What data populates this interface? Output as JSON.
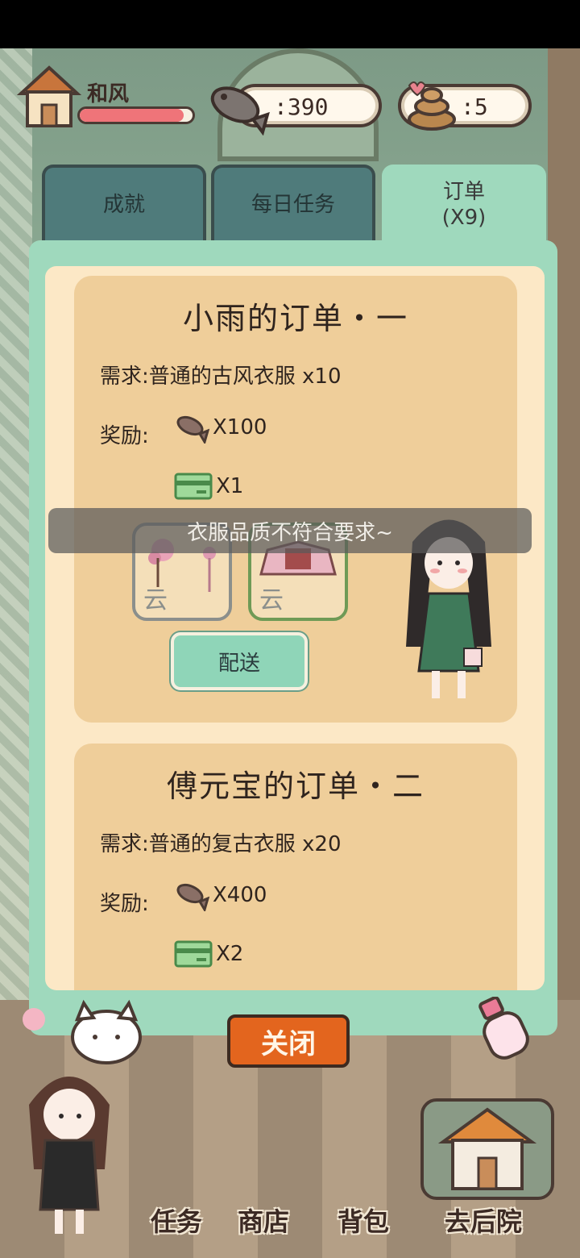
{
  "hud": {
    "player_name": "和风",
    "hp_fraction": 0.92,
    "fish_count": ":390",
    "poop_count": ":5"
  },
  "tabs": {
    "achievement": "成就",
    "daily": "每日任务",
    "order": "订单",
    "order_count": "(X9)"
  },
  "orders": [
    {
      "title": "小雨的订单・一",
      "requirement": "需求:普通的古风衣服 x10",
      "reward_label": "奖励:",
      "reward_fish": "X100",
      "reward_ticket": "X1",
      "deliver_label": "配送"
    },
    {
      "title": "傅元宝的订单・二",
      "requirement": "需求:普通的复古衣服 x20",
      "reward_label": "奖励:",
      "reward_fish": "X400",
      "reward_ticket": "X2"
    }
  ],
  "toast": "衣服品质不符合要求~",
  "close_label": "关闭",
  "nav": {
    "task": "任务",
    "shop": "商店",
    "bag": "背包",
    "yard": "去后院"
  },
  "colors": {
    "panel": "#9fd9bd",
    "card": "#efce9a",
    "close": "#e3651e",
    "hp": "#ef7479"
  }
}
